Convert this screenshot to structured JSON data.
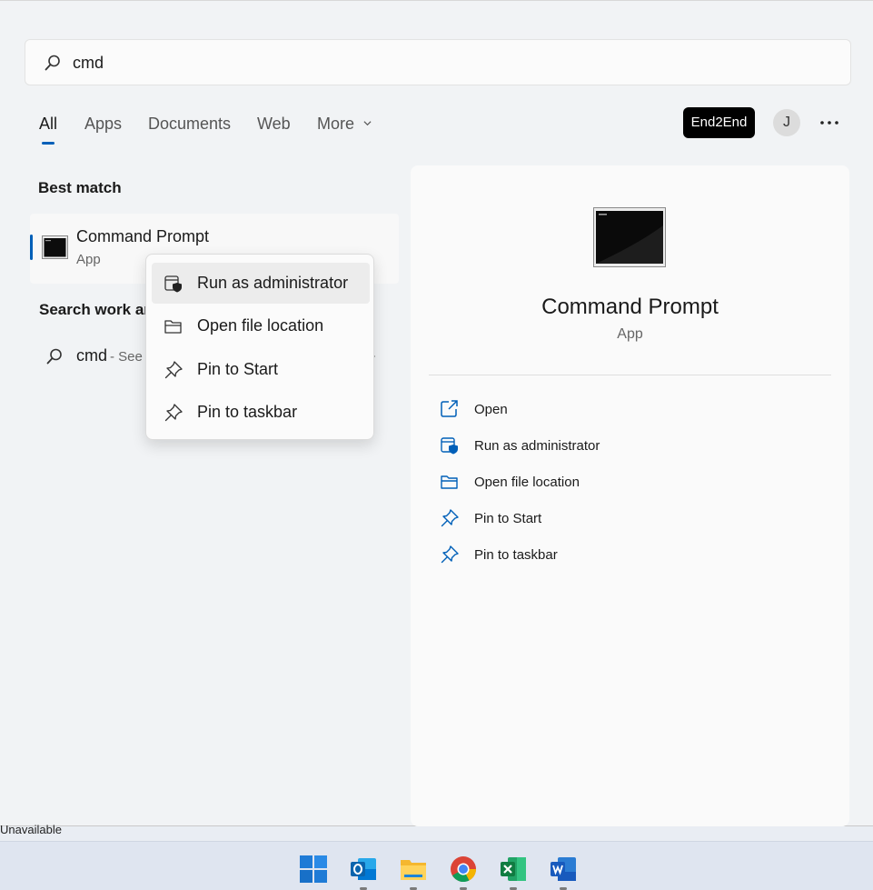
{
  "search": {
    "query": "cmd",
    "placeholder": ""
  },
  "tabs": [
    {
      "label": "All",
      "active": true
    },
    {
      "label": "Apps"
    },
    {
      "label": "Documents"
    },
    {
      "label": "Web"
    },
    {
      "label": "More"
    }
  ],
  "header": {
    "org_label": "End2End",
    "avatar_initial": "J"
  },
  "best_match": {
    "title": "Best match",
    "name": "Command Prompt",
    "type": "App"
  },
  "work": {
    "title": "Search work ar",
    "query": "cmd",
    "hint": "- See"
  },
  "context_menu": [
    {
      "label": "Run as administrator",
      "icon": "shield-admin-icon"
    },
    {
      "label": "Open file location",
      "icon": "folder-icon"
    },
    {
      "label": "Pin to Start",
      "icon": "pin-icon"
    },
    {
      "label": "Pin to taskbar",
      "icon": "pin-icon"
    }
  ],
  "detail": {
    "name": "Command Prompt",
    "type": "App",
    "actions": [
      {
        "label": "Open",
        "icon": "open-external-icon"
      },
      {
        "label": "Run as administrator",
        "icon": "shield-admin-icon"
      },
      {
        "label": "Open file location",
        "icon": "folder-icon"
      },
      {
        "label": "Pin to Start",
        "icon": "pin-icon"
      },
      {
        "label": "Pin to taskbar",
        "icon": "pin-icon"
      }
    ]
  },
  "status": {
    "unavailable": "Unavailable"
  },
  "taskbar": [
    "windows-start-icon",
    "outlook-icon",
    "file-explorer-icon",
    "chrome-icon",
    "excel-icon",
    "word-icon"
  ],
  "colors": {
    "accent": "#005fb8",
    "panel_bg": "#f1f3f5",
    "taskbar_bg": "#dfe5f0"
  }
}
